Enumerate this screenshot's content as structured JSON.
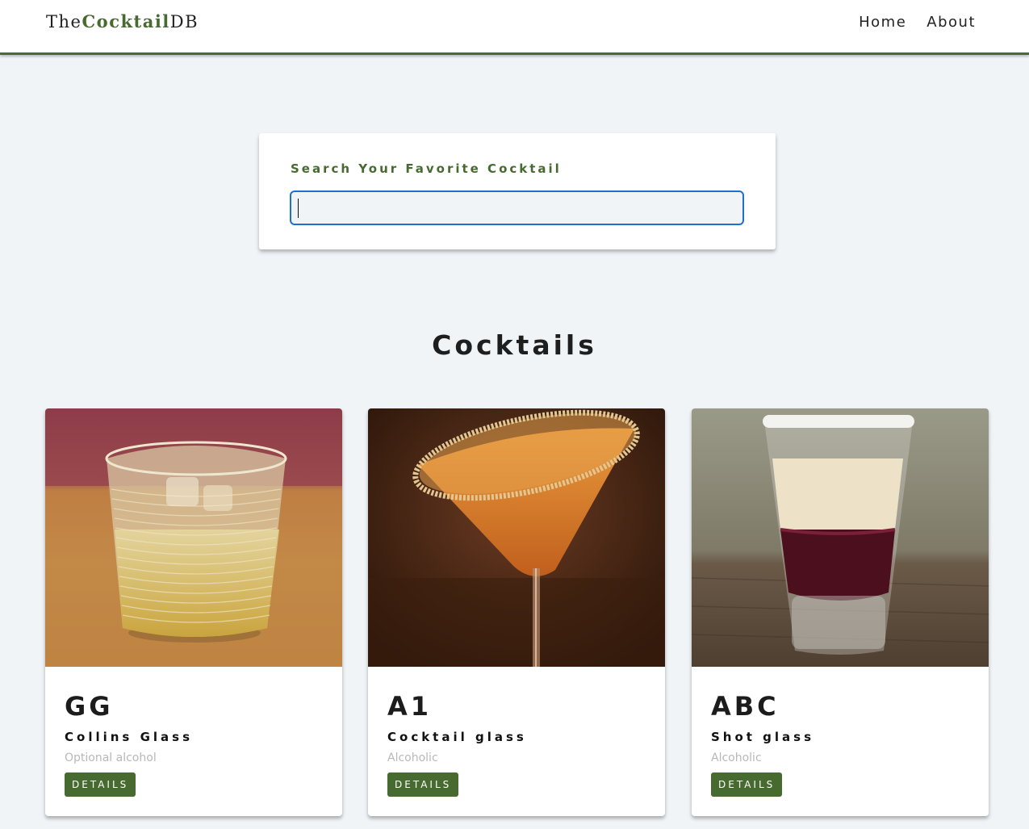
{
  "navbar": {
    "logo_prefix": "The",
    "logo_brand": "Cocktail",
    "logo_suffix": "DB",
    "links": [
      {
        "label": "Home"
      },
      {
        "label": "About"
      }
    ]
  },
  "search": {
    "label": "Search Your Favorite Cocktail",
    "value": "",
    "placeholder": ""
  },
  "section": {
    "title": "Cocktails"
  },
  "cocktails": [
    {
      "name": "GG",
      "glass": "Collins Glass",
      "type": "Optional alcohol",
      "button_label": "DETAILS"
    },
    {
      "name": "A1",
      "glass": "Cocktail glass",
      "type": "Alcoholic",
      "button_label": "DETAILS"
    },
    {
      "name": "ABC",
      "glass": "Shot glass",
      "type": "Alcoholic",
      "button_label": "DETAILS"
    }
  ],
  "colors": {
    "accent": "#476a30",
    "background": "#f0f4f7",
    "input_focus": "#1f6fd0"
  }
}
